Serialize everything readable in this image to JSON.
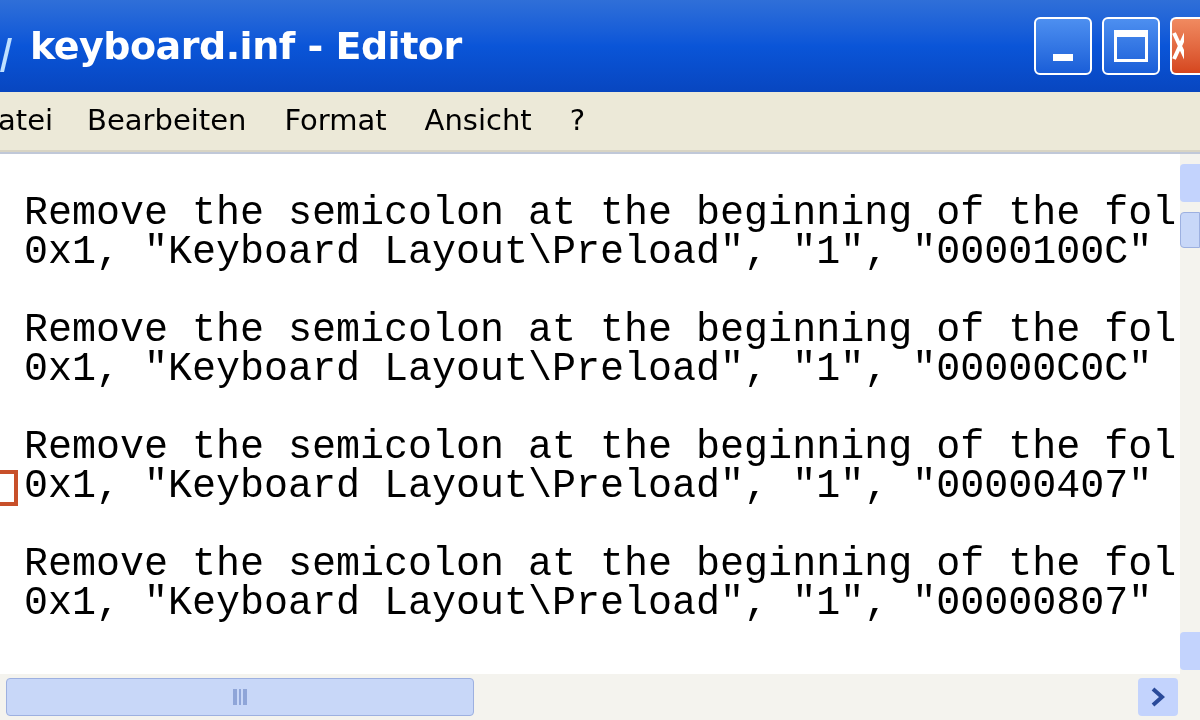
{
  "window": {
    "title": "keyboard.inf - Editor"
  },
  "menu": [
    "atei",
    "Bearbeiten",
    "Format",
    "Ansicht",
    "?"
  ],
  "editor": {
    "blocks": [
      {
        "comment": "Remove the semicolon at the beginning of the fol",
        "code": "0x1, \"Keyboard Layout\\Preload\", \"1\", \"0000100C\"",
        "cursor": false
      },
      {
        "comment": "Remove the semicolon at the beginning of the fol",
        "code": "0x1, \"Keyboard Layout\\Preload\", \"1\", \"00000C0C\"",
        "cursor": false
      },
      {
        "comment": "Remove the semicolon at the beginning of the fol",
        "code": "0x1, \"Keyboard Layout\\Preload\", \"1\", \"00000407\"",
        "cursor": true
      },
      {
        "comment": "Remove the semicolon at the beginning of the fol",
        "code": "0x1, \"Keyboard Layout\\Preload\", \"1\", \"00000807\"",
        "cursor": false
      }
    ]
  }
}
